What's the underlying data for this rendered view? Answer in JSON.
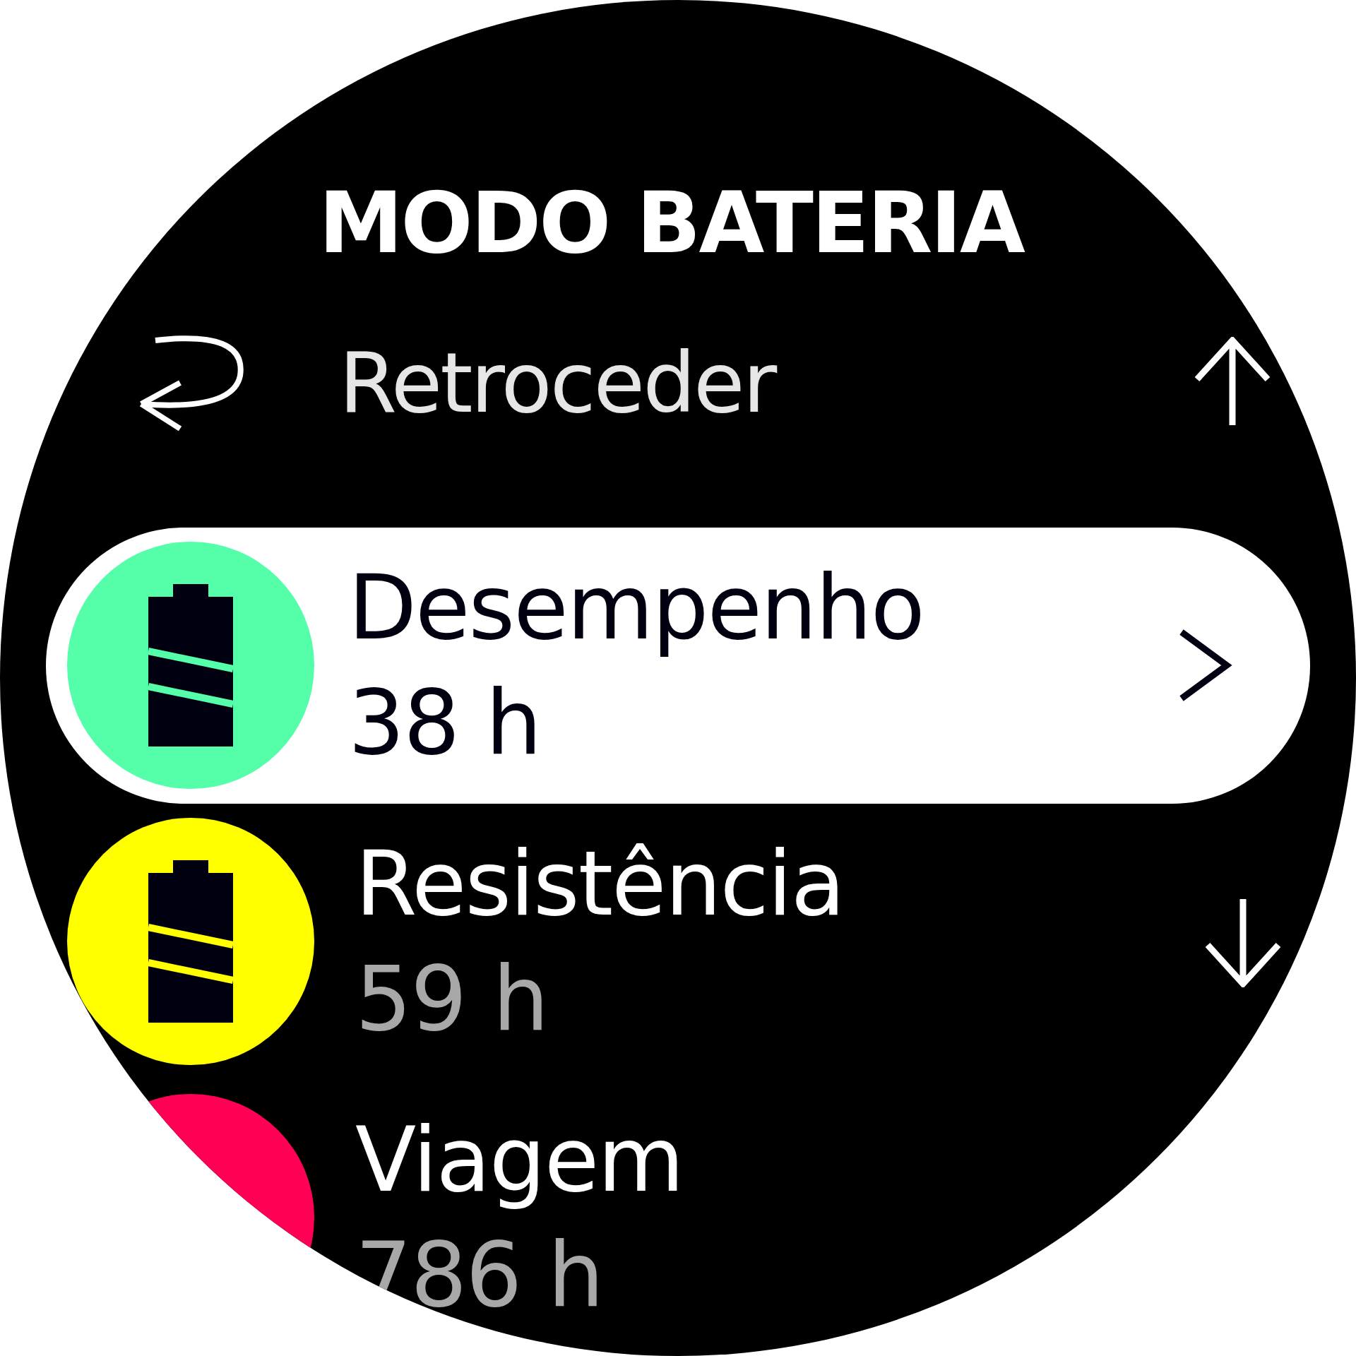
{
  "title": "MODO BATERIA",
  "back": {
    "label": "Retroceder"
  },
  "modes": [
    {
      "name": "Desempenho",
      "duration": "38 h",
      "color": "#55ffaa",
      "selected": true
    },
    {
      "name": "Resistência",
      "duration": "59 h",
      "color": "#ffff00",
      "selected": false
    },
    {
      "name": "Viagem",
      "duration": "786 h",
      "color": "#ff0055",
      "selected": false
    }
  ]
}
